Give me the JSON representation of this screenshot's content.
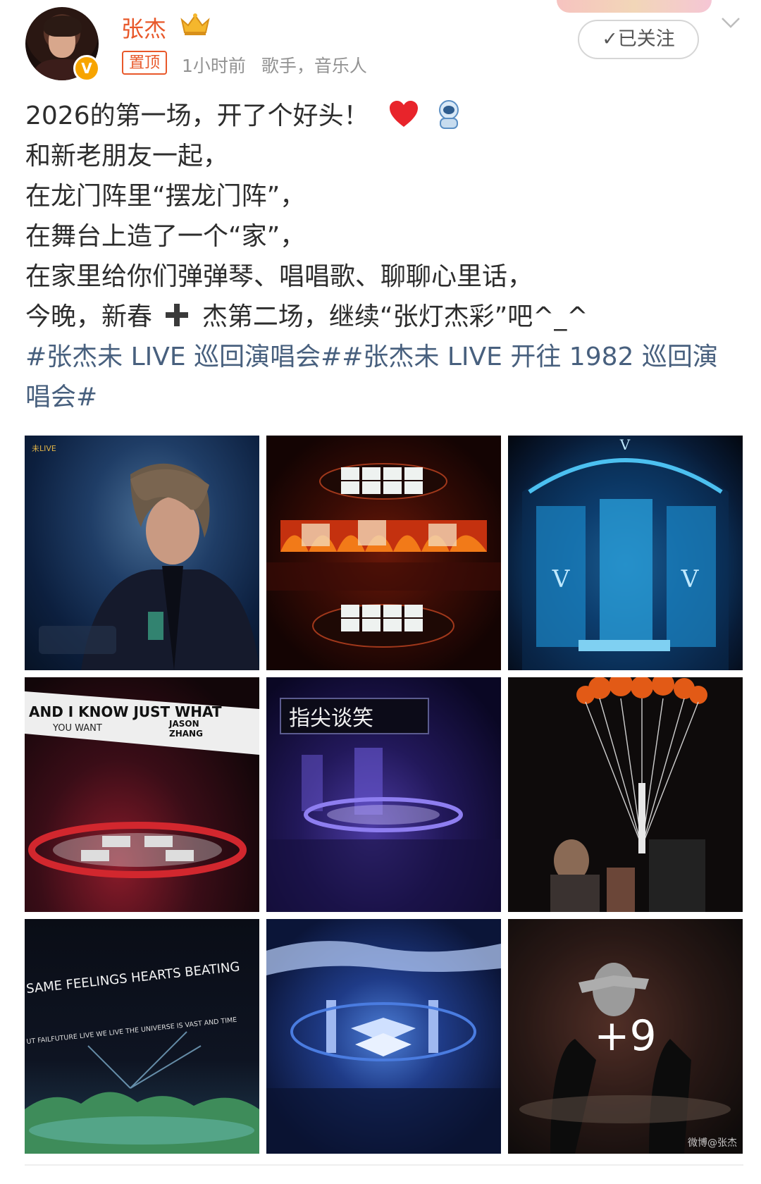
{
  "header": {
    "username": "张杰",
    "verified_badge": "V",
    "pinned_label": "置顶",
    "time": "1小时前",
    "tags": "歌手，音乐人",
    "follow_label": "✓已关注"
  },
  "post": {
    "lines": [
      "2026的第一场，开了个好头！",
      "和新老朋友一起，",
      "在龙门阵里“摆龙门阵”，",
      "在舞台上造了一个“家”，",
      "在家里给你们弹弹琴、唱唱歌、聊聊心里话，"
    ],
    "line6_part1": "今晚，新春",
    "line6_part2": "杰第二场，继续“张灯杰彩”吧^_^",
    "topic_line1": "#张杰未 LIVE 巡回演唱会##张杰未 LIVE 开往 1982 巡回演",
    "topic_line2": "唱会#"
  },
  "photos": {
    "p1_badge": "未LIVE",
    "p4_text1": "AND I KNOW JUST WHAT",
    "p4_text2": "YOU WANT",
    "p4_text3": "JASON",
    "p4_text4": "ZHANG",
    "p5_text": "指尖谈笑",
    "p7_text1": "SAME FEELINGS HEARTS BEATING",
    "p7_text2": "UT FAILFUTURE LIVE WE LIVE THE UNIVERSE IS VAST AND TIME",
    "more_count": "+9",
    "watermark": "微博@张杰"
  },
  "colors": {
    "name_orange": "#e8582a",
    "topic_blue": "#48607e",
    "meta_gray": "#939393"
  }
}
